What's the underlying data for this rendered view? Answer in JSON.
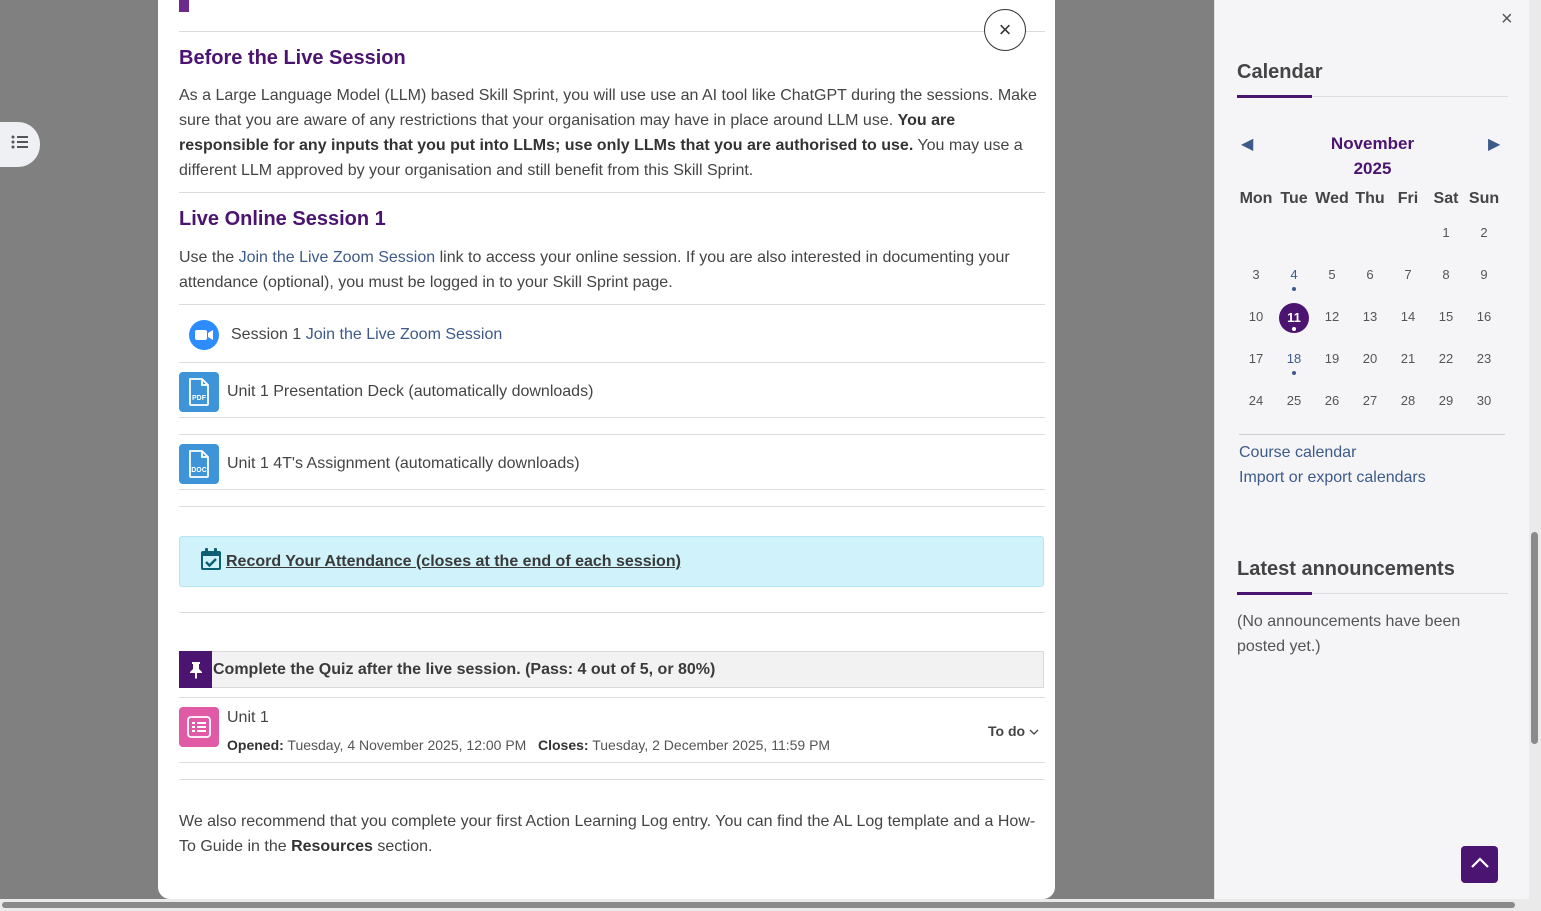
{
  "modal": {
    "close_symbol": "×",
    "before_title": "Before the Live Session",
    "before_p1": "As a Large Language Model (LLM) based Skill Sprint, you will use use an AI tool like ChatGPT during the sessions. Make sure that you are aware of any restrictions that your organisation may have in place around LLM use. ",
    "before_bold": "You are responsible for any inputs that you put into LLMs; use only LLMs that you are authorised to use.",
    "before_p2": " You may use a different LLM approved by your organisation and still benefit from this Skill Sprint.",
    "live_title": "Live Online Session 1",
    "live_p1": "Use the ",
    "live_link": "Join the Live Zoom Session",
    "live_p2": " link to access your online session. If you are also interested in documenting your attendance (optional), you must be logged in to your Skill Sprint page.",
    "zoom_prefix": "Session 1 ",
    "zoom_link": "Join the Live Zoom Session",
    "pdf_label": "Unit 1 Presentation Deck (automatically downloads)",
    "pdf_icon_text": "PDF",
    "doc_label": "Unit 1 4T's Assignment (automatically downloads)",
    "doc_icon_text": "DOC",
    "attendance_label": "Record Your Attendance (closes at the end of each session)",
    "quiz_header": "Complete the Quiz after the live session. (Pass: 4 out of 5, or 80%)",
    "quiz_title": "Unit 1",
    "opened_label": "Opened:",
    "opened_value": " Tuesday, 4 November 2025, 12:00 PM",
    "closes_label": "Closes:",
    "closes_value": " Tuesday, 2 December 2025, 11:59 PM",
    "todo_label": "To do",
    "closing_p1": "We also recommend that you complete your first Action Learning Log entry. You can find the AL Log template and a How-To Guide in the ",
    "closing_bold": "Resources",
    "closing_p2": " section."
  },
  "drawer": {
    "close_symbol": "×",
    "calendar_title": "Calendar",
    "month": "November",
    "year": "2025",
    "prev_symbol": "◀",
    "next_symbol": "▶",
    "weekdays": [
      "Mon",
      "Tue",
      "Wed",
      "Thu",
      "Fri",
      "Sat",
      "Sun"
    ],
    "weeks": [
      [
        "",
        "",
        "",
        "",
        "",
        "1",
        "2"
      ],
      [
        "3",
        "4",
        "5",
        "6",
        "7",
        "8",
        "9"
      ],
      [
        "10",
        "11",
        "12",
        "13",
        "14",
        "15",
        "16"
      ],
      [
        "17",
        "18",
        "19",
        "20",
        "21",
        "22",
        "23"
      ],
      [
        "24",
        "25",
        "26",
        "27",
        "28",
        "29",
        "30"
      ]
    ],
    "event_days": [
      "4",
      "11",
      "18"
    ],
    "today": "11",
    "course_calendar": "Course calendar",
    "import_export": "Import or export calendars",
    "announcements_title": "Latest announcements",
    "announcements_empty": "(No announcements have been posted yet.)"
  },
  "colors": {
    "brand_purple": "#4b1470",
    "link_blue": "#3d5a8a",
    "zoom_blue": "#2d8cff",
    "file_blue": "#3d94d8",
    "quiz_pink": "#e15aa5",
    "attendance_bg": "#cff2fb"
  }
}
